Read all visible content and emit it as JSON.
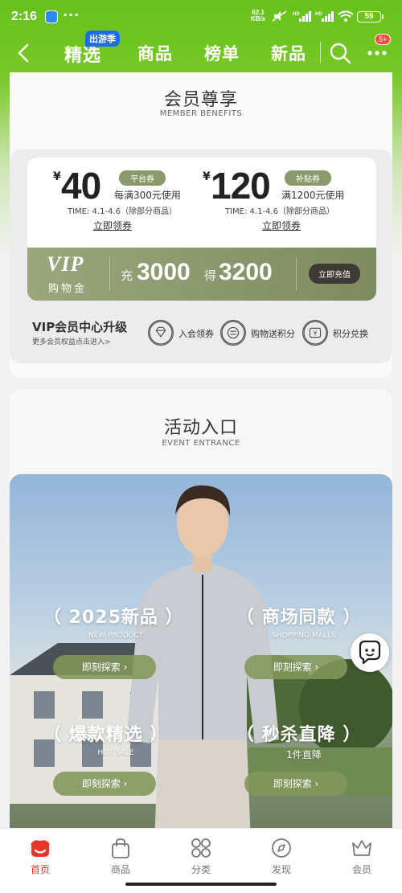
{
  "status_bar": {
    "time": "2:16",
    "dots": "···",
    "net_speed_value": "62.1",
    "net_speed_unit": "KB/s",
    "battery": "59"
  },
  "nav": {
    "tabs": [
      {
        "label": "精选",
        "active": true
      },
      {
        "label": "商品",
        "active": false
      },
      {
        "label": "榜单",
        "active": false
      },
      {
        "label": "新品",
        "active": false
      }
    ],
    "tag": "出游季",
    "message_badge": "5+"
  },
  "member": {
    "title": "会员尊享",
    "subtitle": "MEMBER BENEFITS",
    "coupons": [
      {
        "currency": "¥",
        "amount": "40",
        "tag": "平台券",
        "condition": "每满300元使用",
        "validity": "TIME: 4.1-4.6（除部分商品）",
        "claim": "立即领券"
      },
      {
        "currency": "¥",
        "amount": "120",
        "tag": "补贴券",
        "condition": "满1200元使用",
        "validity": "TIME: 4.1-4.6（除部分商品）",
        "claim": "立即领券"
      }
    ],
    "vip": {
      "logo": "VIP",
      "gold": "购物金",
      "charge_label": "充",
      "charge_amount": "3000",
      "get_label": "得",
      "get_amount": "3200",
      "button": "立即充值"
    },
    "upgrade_title": "VIP会员中心升级",
    "upgrade_sub": "更多会员权益点击进入>",
    "perks": [
      {
        "label": "入会领券",
        "icon": "diamond-icon"
      },
      {
        "label": "购物送积分",
        "icon": "coin-icon"
      },
      {
        "label": "积分兑换",
        "icon": "exchange-icon"
      }
    ]
  },
  "event": {
    "title": "活动入口",
    "subtitle": "EVENT ENTRANCE",
    "categories": [
      {
        "name": "（ 2025新品 ）",
        "sub": "NEW PRODUCT",
        "button": "即刻探索 ›"
      },
      {
        "name": "（ 商场同款 ）",
        "sub": "SHOPPING MALLS",
        "button": "即刻探索 ›"
      },
      {
        "name": "（ 爆款精选 ）",
        "sub": "HOT SALE",
        "button": "即刻探索 ›"
      },
      {
        "name": "（ 秒杀直降 ）",
        "sub": "1件直降",
        "button": "即刻探索 ›"
      }
    ]
  },
  "bottom_nav": [
    {
      "label": "首页",
      "icon": "home-icon",
      "active": true
    },
    {
      "label": "商品",
      "icon": "bag-icon",
      "active": false
    },
    {
      "label": "分类",
      "icon": "category-icon",
      "active": false
    },
    {
      "label": "发现",
      "icon": "compass-icon",
      "active": false
    },
    {
      "label": "会员",
      "icon": "crown-icon",
      "active": false
    }
  ],
  "colors": {
    "header_green": "#67c21b",
    "olive": "#8a9a6c",
    "active_red": "#e5362b"
  }
}
